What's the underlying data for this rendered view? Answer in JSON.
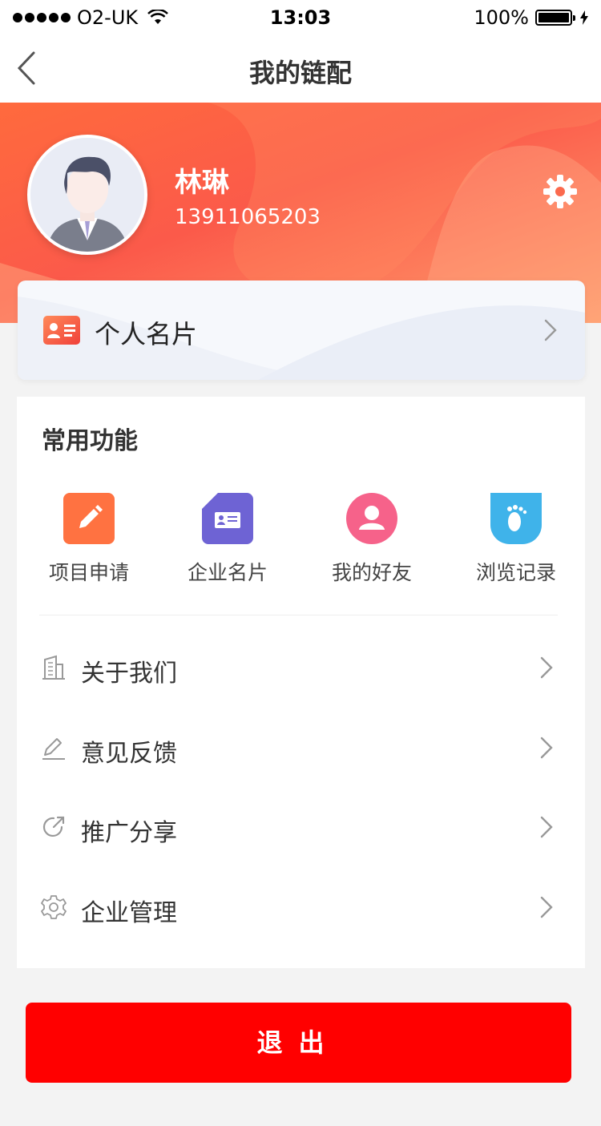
{
  "status_bar": {
    "carrier": "O2-UK",
    "time": "13:03",
    "battery": "100%"
  },
  "nav": {
    "title": "我的链配",
    "back_icon": "chevron-left-icon"
  },
  "profile": {
    "name": "林琳",
    "phone": "13911065203",
    "avatar_icon": "male-avatar-icon",
    "settings_icon": "gear-icon"
  },
  "business_card": {
    "label": "个人名片",
    "icon": "id-card-icon"
  },
  "common_functions": {
    "title": "常用功能",
    "items": [
      {
        "label": "项目申请",
        "icon": "pencil-icon",
        "color": "#ff7241"
      },
      {
        "label": "企业名片",
        "icon": "company-card-icon",
        "color": "#6e63d4"
      },
      {
        "label": "我的好友",
        "icon": "friend-user-icon",
        "color": "#f6628a"
      },
      {
        "label": "浏览记录",
        "icon": "footprint-icon",
        "color": "#3fb3ea"
      }
    ]
  },
  "menu": [
    {
      "label": "关于我们",
      "icon": "building-icon"
    },
    {
      "label": "意见反馈",
      "icon": "feedback-pencil-icon"
    },
    {
      "label": "推广分享",
      "icon": "share-icon"
    },
    {
      "label": "企业管理",
      "icon": "gear-outline-icon"
    }
  ],
  "logout": {
    "label": "退出",
    "color": "#ff0000"
  },
  "colors": {
    "header_start": "#ff6a3d",
    "header_end": "#ff9d6c",
    "accent_red": "#ff0000"
  }
}
